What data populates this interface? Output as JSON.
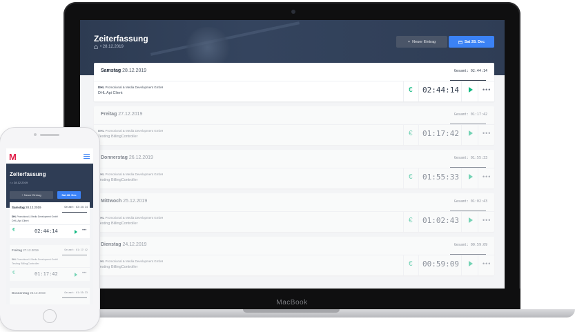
{
  "laptop": {
    "brand": "MacBook",
    "app": {
      "title": "Zeiterfassung",
      "breadcrumb_date": "• 28.12.2019",
      "new_entry_label": "Neuer Eintrag",
      "date_button_label": "Sat 28. Dec",
      "days": [
        {
          "weekday": "Samstag",
          "date": "28.12.2019",
          "total_label": "Gesamt:",
          "total": "02:44:14",
          "company_bold": "DHL",
          "company_rest": "Promotional & Media Development GmbH",
          "project": "DHL Api Client",
          "currency": "€",
          "time": "02:44:14"
        },
        {
          "weekday": "Freitag",
          "date": "27.12.2019",
          "total_label": "Gesamt:",
          "total": "01:17:42",
          "company_bold": "DHL",
          "company_rest": "Promotional & Media Development GmbH",
          "project": "Testing BillingController",
          "currency": "€",
          "time": "01:17:42"
        },
        {
          "weekday": "Donnerstag",
          "date": "26.12.2019",
          "total_label": "Gesamt:",
          "total": "01:55:33",
          "company_bold": "DHL",
          "company_rest": "Promotional & Media Development GmbH",
          "project": "Testing BillingController",
          "currency": "€",
          "time": "01:55:33"
        },
        {
          "weekday": "Mittwoch",
          "date": "25.12.2019",
          "total_label": "Gesamt:",
          "total": "01:02:43",
          "company_bold": "DHL",
          "company_rest": "Promotional & Media Development GmbH",
          "project": "Testing BillingController",
          "currency": "€",
          "time": "01:02:43"
        },
        {
          "weekday": "Dienstag",
          "date": "24.12.2019",
          "total_label": "Gesamt:",
          "total": "00:59:09",
          "company_bold": "DHL",
          "company_rest": "Promotional & Media Development GmbH",
          "project": "Testing BillingController",
          "currency": "€",
          "time": "00:59:09"
        }
      ]
    }
  },
  "phone": {
    "logo": "M",
    "title": "Zeiterfassung",
    "breadcrumb_date": "• 28.12.2019",
    "new_entry_label": "+ Neuer Eintrag",
    "date_button_label": "Sat 28. Dec",
    "days": [
      {
        "weekday": "Samstag",
        "date": "28.12.2019",
        "total": "Gesamt: 02:44:14",
        "company_bold": "DHL",
        "company_rest": "Promotional & Media Development GmbH",
        "project": "DHL Api Client",
        "currency": "€",
        "time": "02:44:14"
      },
      {
        "weekday": "Freitag",
        "date": "27.12.2019",
        "total": "Gesamt: 01:17:42",
        "company_bold": "DHL",
        "company_rest": "Promotional & Media Development GmbH",
        "project": "Testing BillingController",
        "currency": "€",
        "time": "01:17:42"
      },
      {
        "weekday": "Donnerstag",
        "date": "26.12.2019",
        "total": "Gesamt: 01:55:33"
      }
    ]
  },
  "colors": {
    "hero": "#2f3d55",
    "primary": "#3b82f6",
    "accent_green": "#10b981",
    "logo_pink": "#e11d48"
  }
}
